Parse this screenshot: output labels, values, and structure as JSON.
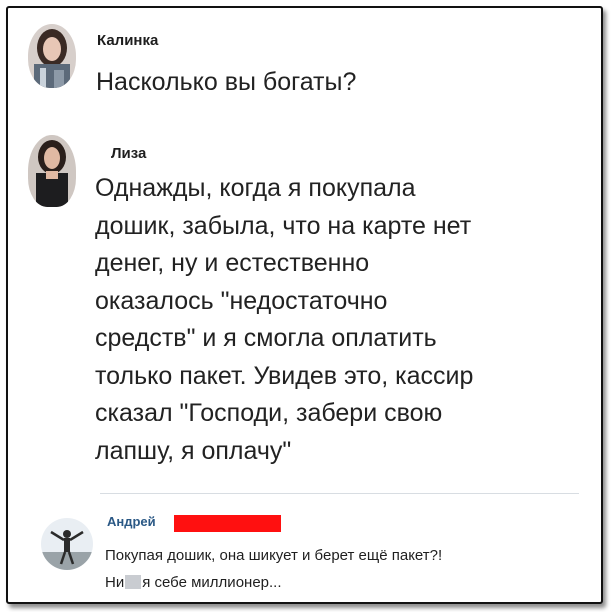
{
  "post1": {
    "author": "Калинка",
    "text": "Насколько вы богаты?"
  },
  "post2": {
    "author": "Лиза",
    "lines": [
      "Однажды, когда я покупала",
      "дошик, забыла, что на карте нет",
      "денег, ну и естественно",
      "оказалось \"недостаточно",
      "средств\" и я смогла оплатить",
      "только пакет. Увидев это, кассир",
      "сказал \"Господи, забери свою",
      "лапшу, я оплачу\""
    ]
  },
  "comment": {
    "author": "Андрей",
    "line1": "Покупая дошик, она шикует и берет ещё пакет?!",
    "line2_start": "Ни",
    "line2_end": "я себе миллионер...",
    "name_color": "#2a5885",
    "redaction_color": "#ff1010"
  }
}
